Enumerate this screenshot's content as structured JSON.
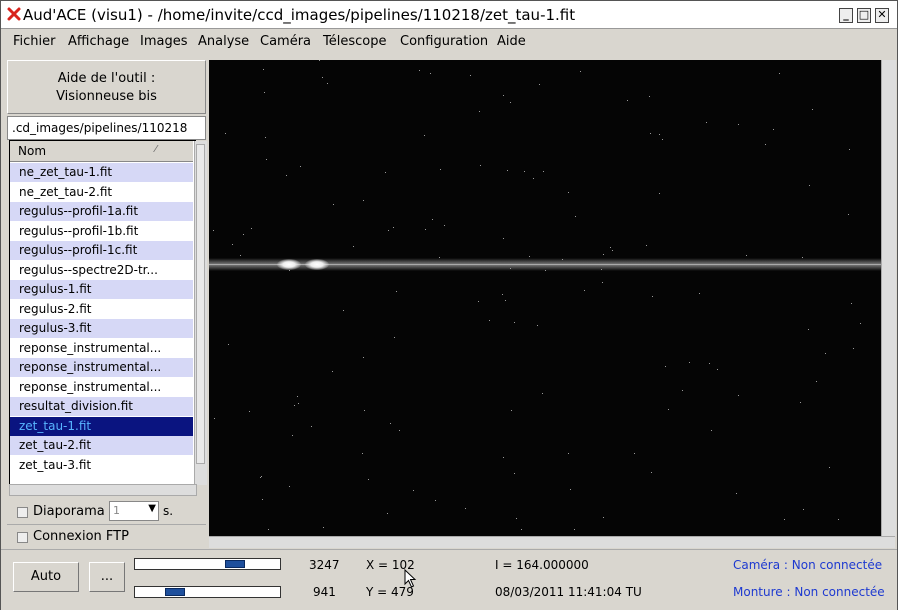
{
  "window": {
    "title": "Aud'ACE (visu1) - /home/invite/ccd_images/pipelines/110218/zet_tau-1.fit"
  },
  "menu": [
    "Fichier",
    "Affichage",
    "Images",
    "Analyse",
    "Caméra",
    "Télescope",
    "Configuration",
    "Aide"
  ],
  "sidebar": {
    "help_line1": "Aide de l'outil :",
    "help_line2": "Visionneuse bis",
    "path": ".cd_images/pipelines/110218",
    "column_header": "Nom",
    "files": [
      "ne_zet_tau-1.fit",
      "ne_zet_tau-2.fit",
      "regulus--profil-1a.fit",
      "regulus--profil-1b.fit",
      "regulus--profil-1c.fit",
      "regulus--spectre2D-tr...",
      "regulus-1.fit",
      "regulus-2.fit",
      "regulus-3.fit",
      "reponse_instrumental...",
      "reponse_instrumental...",
      "reponse_instrumental...",
      "resultat_division.fit",
      "zet_tau-1.fit",
      "zet_tau-2.fit",
      "zet_tau-3.fit"
    ],
    "selected_file": "zet_tau-1.fit",
    "diaporama_label": "Diaporama",
    "diaporama_value": "1",
    "diaporama_unit": "s.",
    "ftp_label": "Connexion FTP"
  },
  "status": {
    "auto_button": "Auto",
    "more_button": "...",
    "high_threshold": "3247",
    "low_threshold": "941",
    "high_slider_level": 0.72,
    "low_slider_level": 0.24,
    "x_coord": "X = 102",
    "y_coord": "Y = 479",
    "intensity": "I = 164.000000",
    "datetime": "08/03/2011 11:41:04 TU",
    "camera": "Caméra : Non connectée",
    "mount": "Monture : Non connectée"
  },
  "icons": [
    "close-x-icon",
    "minimize-icon",
    "maximize-icon",
    "close-icon",
    "sort-icon",
    "dropdown-arrow-icon",
    "mouse-cursor-icon"
  ]
}
